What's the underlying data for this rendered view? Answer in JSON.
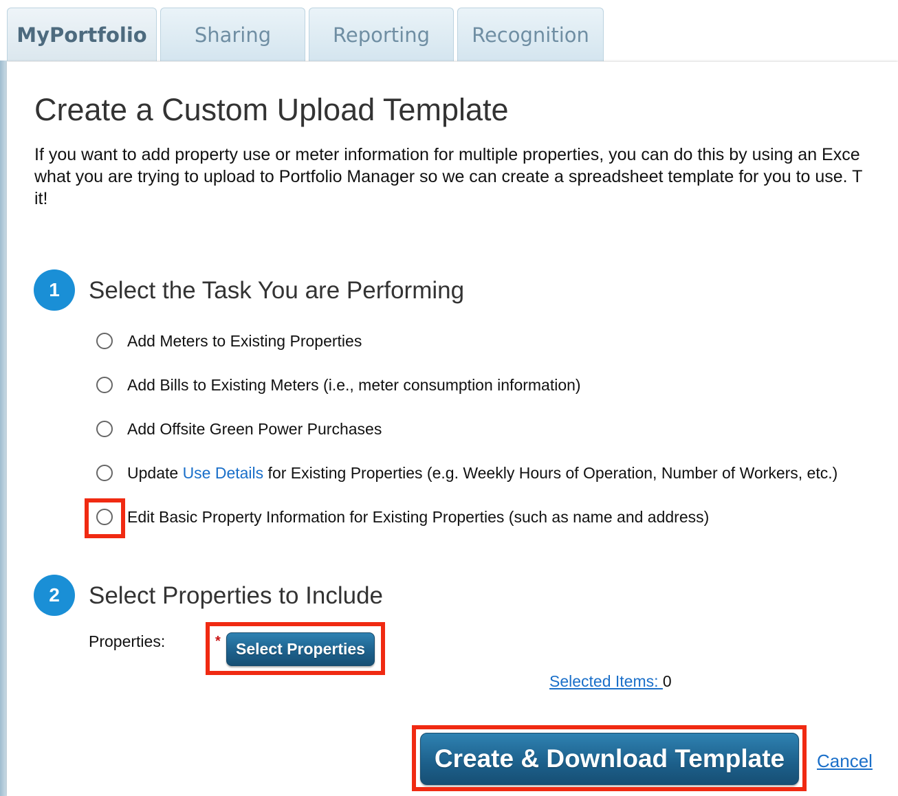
{
  "tabs": [
    {
      "label": "MyPortfolio",
      "active": true
    },
    {
      "label": "Sharing",
      "active": false
    },
    {
      "label": "Reporting",
      "active": false
    },
    {
      "label": "Recognition",
      "active": false
    }
  ],
  "page": {
    "title": "Create a Custom Upload Template",
    "intro_lines": [
      "If you want to add property use or meter information for multiple properties, you can do this by using an Exce",
      "what you are trying to upload to Portfolio Manager so we can create a spreadsheet template for you to use. T",
      "it!"
    ]
  },
  "step1": {
    "number": "1",
    "title": "Select the Task You are Performing",
    "options": [
      {
        "text": "Add Meters to Existing Properties"
      },
      {
        "text": "Add Bills to Existing Meters (i.e., meter consumption information)"
      },
      {
        "text": "Add Offsite Green Power Purchases"
      },
      {
        "prefix": "Update ",
        "link": "Use Details",
        "suffix": " for Existing Properties (e.g. Weekly Hours of Operation, Number of Workers, etc.)"
      },
      {
        "text": "Edit Basic Property Information for Existing Properties (such as name and address)"
      }
    ]
  },
  "step2": {
    "number": "2",
    "title": "Select Properties to Include",
    "properties_label": "Properties:",
    "required_mark": "*",
    "select_button": "Select Properties",
    "selected_items_link": "Selected Items: ",
    "selected_items_count": "0"
  },
  "actions": {
    "create_button": "Create & Download Template",
    "cancel_link": "Cancel"
  },
  "colors": {
    "highlight": "#f02a12",
    "step_circle": "#1a8fd6",
    "link": "#1a6fc9",
    "button": "#1c5f8a"
  }
}
